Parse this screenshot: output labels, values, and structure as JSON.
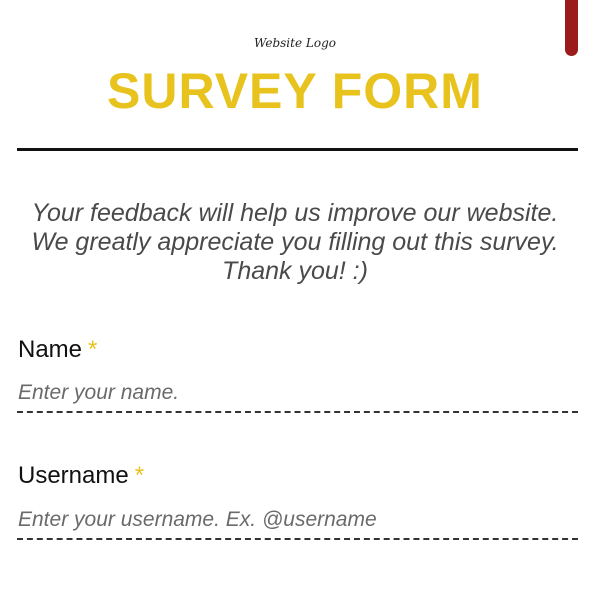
{
  "header": {
    "logo_text": "Website Logo",
    "title": "SURVEY FORM"
  },
  "intro": {
    "lines": [
      "Your feedback will help us improve our website.",
      "We greatly appreciate you filling out this survey.",
      "Thank you! :)"
    ]
  },
  "form": {
    "fields": [
      {
        "label": "Name",
        "required_mark": "*",
        "placeholder": "Enter your name."
      },
      {
        "label": "Username",
        "required_mark": "*",
        "placeholder": "Enter your username. Ex. @username"
      }
    ]
  },
  "colors": {
    "accent": "#e8c31e",
    "scrollbar": "#9b1b1b",
    "divider": "#111111"
  }
}
